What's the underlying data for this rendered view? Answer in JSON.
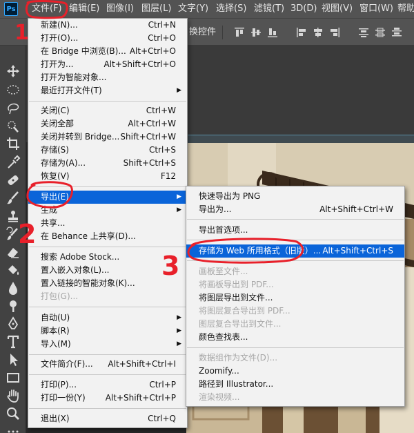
{
  "app": {
    "logo": "Ps"
  },
  "menubar": {
    "items": [
      "文件(F)",
      "编辑(E)",
      "图像(I)",
      "图层(L)",
      "文字(Y)",
      "选择(S)",
      "滤镜(T)",
      "3D(D)",
      "视图(V)",
      "窗口(W)",
      "帮助"
    ]
  },
  "options_bar": {
    "transform_controls_label": "换控件"
  },
  "file_menu": {
    "items": [
      {
        "label": "新建(N)...",
        "shortcut": "Ctrl+N"
      },
      {
        "label": "打开(O)...",
        "shortcut": "Ctrl+O"
      },
      {
        "label": "在 Bridge 中浏览(B)...",
        "shortcut": "Alt+Ctrl+O"
      },
      {
        "label": "打开为...",
        "shortcut": "Alt+Shift+Ctrl+O"
      },
      {
        "label": "打开为智能对象..."
      },
      {
        "label": "最近打开文件(T)",
        "submenu": true
      },
      {
        "label": "关闭(C)",
        "shortcut": "Ctrl+W"
      },
      {
        "label": "关闭全部",
        "shortcut": "Alt+Ctrl+W"
      },
      {
        "label": "关闭并转到 Bridge...",
        "shortcut": "Shift+Ctrl+W"
      },
      {
        "label": "存储(S)",
        "shortcut": "Ctrl+S"
      },
      {
        "label": "存储为(A)...",
        "shortcut": "Shift+Ctrl+S"
      },
      {
        "label": "恢复(V)",
        "shortcut": "F12"
      },
      {
        "label": "导出(E)",
        "submenu": true,
        "highlighted": true
      },
      {
        "label": "生成",
        "submenu": true
      },
      {
        "label": "共享..."
      },
      {
        "label": "在 Behance 上共享(D)..."
      },
      {
        "label": "搜索 Adobe Stock..."
      },
      {
        "label": "置入嵌入对象(L)..."
      },
      {
        "label": "置入链接的智能对象(K)..."
      },
      {
        "label": "打包(G)...",
        "disabled": true
      },
      {
        "label": "自动(U)",
        "submenu": true
      },
      {
        "label": "脚本(R)",
        "submenu": true
      },
      {
        "label": "导入(M)",
        "submenu": true
      },
      {
        "label": "文件简介(F)...",
        "shortcut": "Alt+Shift+Ctrl+I"
      },
      {
        "label": "打印(P)...",
        "shortcut": "Ctrl+P"
      },
      {
        "label": "打印一份(Y)",
        "shortcut": "Alt+Shift+Ctrl+P"
      },
      {
        "label": "退出(X)",
        "shortcut": "Ctrl+Q"
      }
    ]
  },
  "export_menu": {
    "items": [
      {
        "label": "快速导出为 PNG"
      },
      {
        "label": "导出为...",
        "shortcut": "Alt+Shift+Ctrl+W"
      },
      {
        "label": "导出首选项..."
      },
      {
        "label": "存储为 Web 所用格式（旧版）...",
        "shortcut": "Alt+Shift+Ctrl+S",
        "highlighted": true
      },
      {
        "label": "画板至文件...",
        "disabled": true
      },
      {
        "label": "将画板导出到 PDF...",
        "disabled": true
      },
      {
        "label": "将图层导出到文件..."
      },
      {
        "label": "将图层复合导出到 PDF...",
        "disabled": true
      },
      {
        "label": "图层复合导出到文件...",
        "disabled": true
      },
      {
        "label": "颜色查找表..."
      },
      {
        "label": "数据组作为文件(D)...",
        "disabled": true
      },
      {
        "label": "Zoomify..."
      },
      {
        "label": "路径到 Illustrator..."
      },
      {
        "label": "渲染视频...",
        "disabled": true
      }
    ]
  },
  "annotations": [
    "1",
    "2",
    "3"
  ],
  "colors": {
    "highlight": "#0a64d9",
    "annotation": "#e8202a",
    "menu_bg": "#f2f2f2",
    "chrome": "#535353"
  }
}
